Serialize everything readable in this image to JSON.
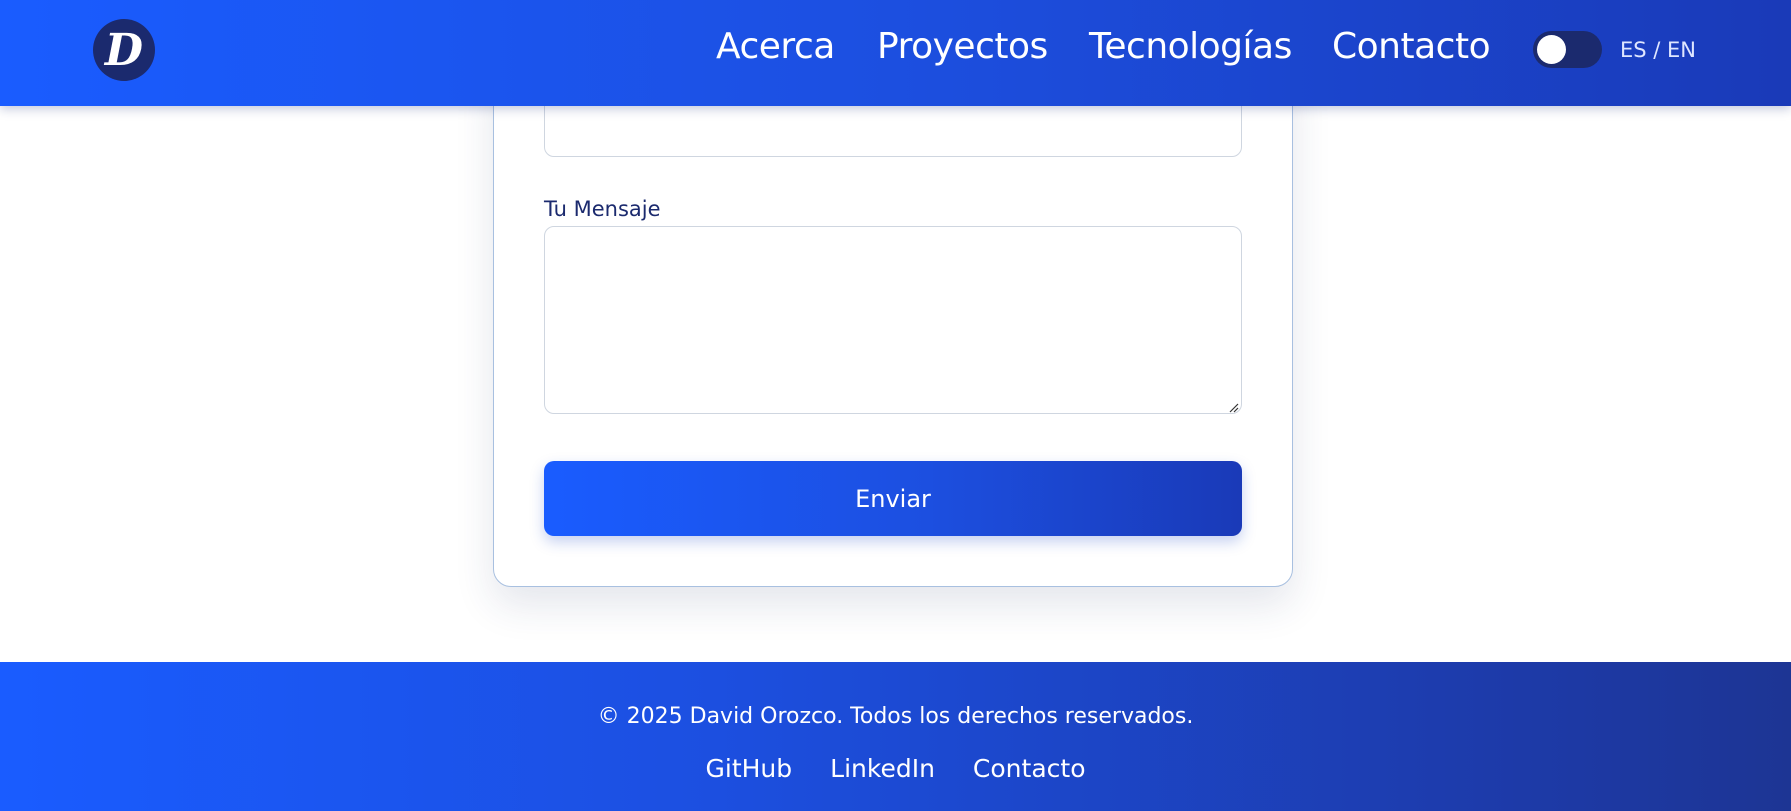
{
  "header": {
    "logo_letter": "D",
    "nav": [
      {
        "label": "Acerca"
      },
      {
        "label": "Proyectos"
      },
      {
        "label": "Tecnologías"
      },
      {
        "label": "Contacto"
      }
    ],
    "theme_toggle_on": false,
    "language_switch": "ES / EN"
  },
  "form": {
    "message_label": "Tu Mensaje",
    "message_value": "",
    "submit_label": "Enviar"
  },
  "footer": {
    "copyright": "© 2025 David Orozco. Todos los derechos reservados.",
    "links": [
      {
        "label": "GitHub"
      },
      {
        "label": "LinkedIn"
      },
      {
        "label": "Contacto"
      }
    ]
  },
  "colors": {
    "brand_blue": "#1a5cff",
    "brand_dark": "#1b2a6e",
    "label_text": "#1b2a6e"
  }
}
